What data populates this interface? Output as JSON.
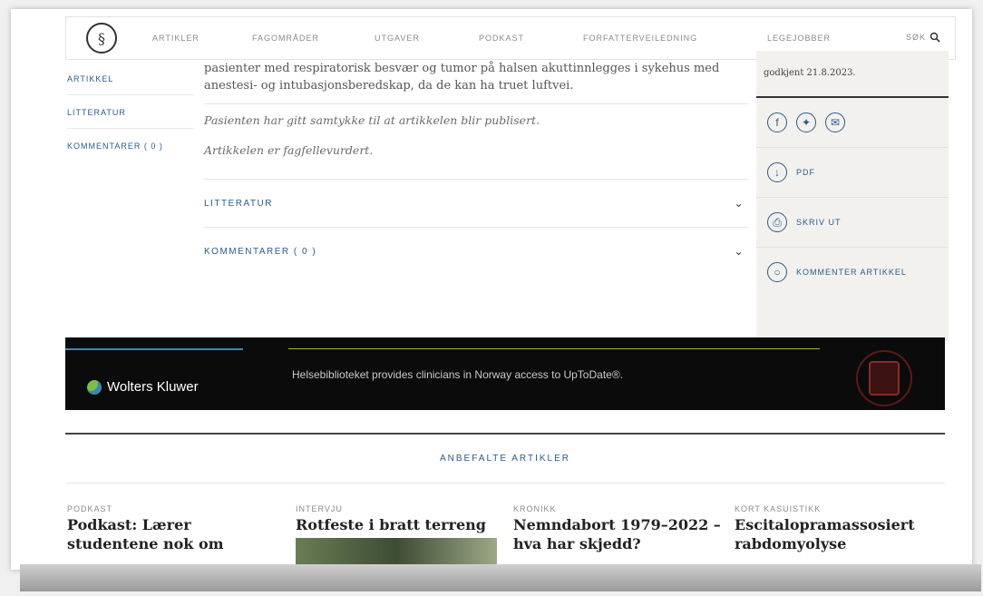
{
  "nav": {
    "logo_glyph": "§",
    "items": [
      "ARTIKLER",
      "FAGOMRÅDER",
      "UTGAVER",
      "PODKAST",
      "FORFATTERVEILEDNING",
      "LEGEJOBBER"
    ],
    "search_label": "SØK"
  },
  "leftnav": {
    "items": [
      "ARTIKKEL",
      "LITTERATUR",
      "KOMMENTARER ( 0 )"
    ]
  },
  "article": {
    "intro": "pasienter med respiratorisk besvær og tumor på halsen akuttinnlegges i sykehus med anestesi- og intubasjonsberedskap, da de kan ha truet luftvei.",
    "consent": "Pasienten har gitt samtykke til at artikkelen blir publisert.",
    "peer_review": "Artikkelen er fagfellevurdert.",
    "accordion": [
      "LITTERATUR",
      "KOMMENTARER ( 0 )"
    ]
  },
  "sidebar": {
    "note": "godkjent 21.8.2023.",
    "share_icons": [
      "facebook-icon",
      "twitter-icon",
      "email-icon"
    ],
    "actions": [
      {
        "icon": "download-icon",
        "label": "PDF"
      },
      {
        "icon": "print-icon",
        "label": "SKRIV UT"
      },
      {
        "icon": "comment-icon",
        "label": "KOMMENTER ARTIKKEL"
      }
    ]
  },
  "banner": {
    "brand": "Wolters Kluwer",
    "message": "Helsebiblioteket provides clinicians in Norway access to UpToDate®."
  },
  "recommended": {
    "heading": "ANBEFALTE ARTIKLER",
    "cards": [
      {
        "kicker": "PODKAST",
        "title": "Podkast: Lærer studentene nok om"
      },
      {
        "kicker": "INTERVJU",
        "title": "Rotfeste i bratt terreng"
      },
      {
        "kicker": "KRONIKK",
        "title": "Nemndabort 1979–2022 – hva har skjedd?"
      },
      {
        "kicker": "KORT KASUISTIKK",
        "title": "Escitalopramassosiert rabdomyolyse"
      }
    ]
  },
  "colors": {
    "link": "#2a5b8c",
    "banner_bg": "#0b0b0b"
  }
}
